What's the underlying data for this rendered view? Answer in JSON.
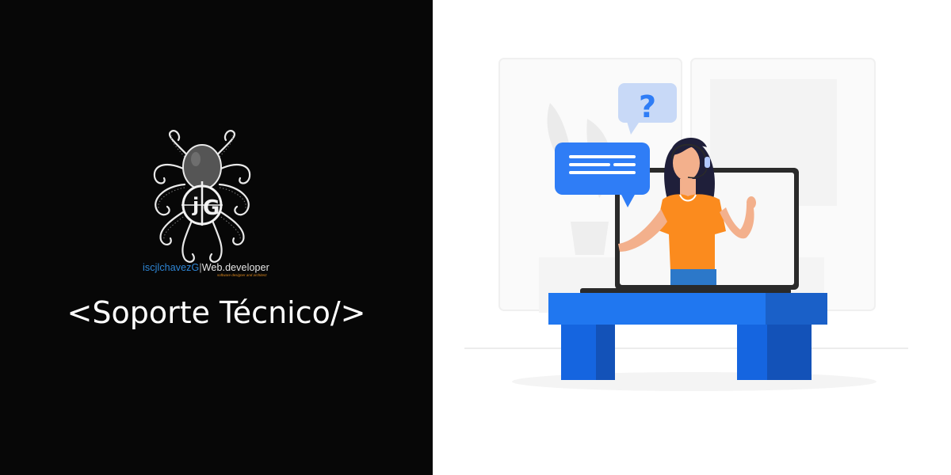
{
  "logo": {
    "brand_prefix": "iscjlchavezG",
    "separator": "|",
    "brand_suffix": "Web.developer",
    "tagline": "software designer and architect",
    "monogram": "G"
  },
  "title": "<Soporte Técnico/>",
  "illustration": {
    "question_mark": "?"
  },
  "colors": {
    "left_background": "#070707",
    "accent_blue": "#1565e0",
    "bubble_blue": "#2f7df6",
    "shirt_orange": "#fb8b1e",
    "brand_blue": "#2e86d6",
    "tagline_orange": "#e08a1e"
  }
}
